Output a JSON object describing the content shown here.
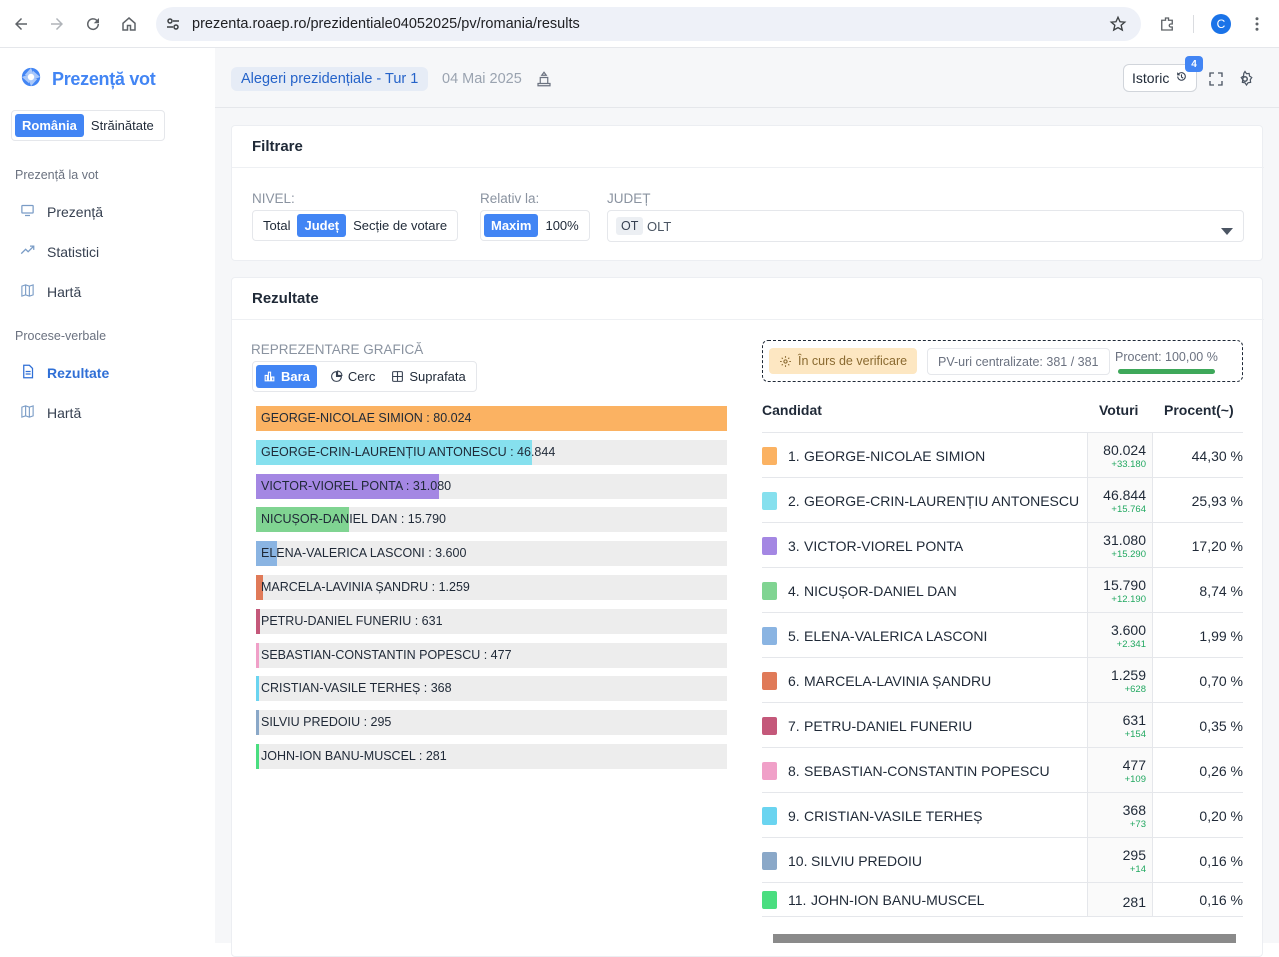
{
  "browser": {
    "url": "prezenta.roaep.ro/prezidentiale04052025/pv/romania/results",
    "profile_initial": "C"
  },
  "sidebar": {
    "app_name": "Prezență vot",
    "scope_tabs": [
      {
        "label": "România",
        "active": true
      },
      {
        "label": "Străinătate",
        "active": false
      }
    ],
    "section1_title": "Prezență la vot",
    "section1_items": [
      {
        "label": "Prezență",
        "icon": "monitor-icon"
      },
      {
        "label": "Statistici",
        "icon": "trend-icon"
      },
      {
        "label": "Hartă",
        "icon": "map-icon"
      }
    ],
    "section2_title": "Procese-verbale",
    "section2_items": [
      {
        "label": "Rezultate",
        "icon": "document-icon",
        "active": true
      },
      {
        "label": "Hartă",
        "icon": "map-icon"
      }
    ]
  },
  "header": {
    "election": "Alegeri prezidențiale - Tur 1",
    "date": "04 Mai 2025",
    "history_label": "Istoric",
    "history_badge": "4"
  },
  "filters": {
    "title": "Filtrare",
    "level_label": "NIVEL:",
    "level_options": [
      {
        "label": "Total",
        "active": false
      },
      {
        "label": "Județ",
        "active": true
      },
      {
        "label": "Secție de votare",
        "active": false
      }
    ],
    "relative_label": "Relativ la:",
    "relative_options": [
      {
        "label": "Maxim",
        "active": true
      },
      {
        "label": "100%",
        "active": false
      }
    ],
    "county_label": "JUDEȚ",
    "county_code": "OT",
    "county_name": "OLT"
  },
  "results": {
    "title": "Rezultate",
    "chart_label": "REPREZENTARE GRAFICĂ",
    "chart_modes": [
      {
        "label": "Bara",
        "active": true
      },
      {
        "label": "Cerc",
        "active": false
      },
      {
        "label": "Suprafata",
        "active": false
      }
    ],
    "status": "În curs de verificare",
    "pv_centralized": "PV-uri centralizate: 381 / 381",
    "percent_label": "Procent: 100,00 %",
    "percent_value": 100,
    "table_headers": {
      "candidate": "Candidat",
      "votes": "Voturi",
      "percent": "Procent(~)"
    },
    "candidates": [
      {
        "rank": "1.",
        "name": "GEORGE-NICOLAE SIMION",
        "votes": "80.024",
        "delta": "+33.180",
        "pct": "44,30 %",
        "color": "#fbb262"
      },
      {
        "rank": "2.",
        "name": "GEORGE-CRIN-LAURENȚIU ANTONESCU",
        "votes": "46.844",
        "delta": "+15.764",
        "pct": "25,93 %",
        "color": "#86e0ee"
      },
      {
        "rank": "3.",
        "name": "VICTOR-VIOREL PONTA",
        "votes": "31.080",
        "delta": "+15.290",
        "pct": "17,20 %",
        "color": "#a487e3"
      },
      {
        "rank": "4.",
        "name": "NICUȘOR-DANIEL DAN",
        "votes": "15.790",
        "delta": "+12.190",
        "pct": "8,74 %",
        "color": "#80d492"
      },
      {
        "rank": "5.",
        "name": "ELENA-VALERICA LASCONI",
        "votes": "3.600",
        "delta": "+2.341",
        "pct": "1,99 %",
        "color": "#8ab4e2"
      },
      {
        "rank": "6.",
        "name": "MARCELA-LAVINIA ȘANDRU",
        "votes": "1.259",
        "delta": "+628",
        "pct": "0,70 %",
        "color": "#e07a58"
      },
      {
        "rank": "7.",
        "name": "PETRU-DANIEL FUNERIU",
        "votes": "631",
        "delta": "+154",
        "pct": "0,35 %",
        "color": "#c4587a"
      },
      {
        "rank": "8.",
        "name": "SEBASTIAN-CONSTANTIN POPESCU",
        "votes": "477",
        "delta": "+109",
        "pct": "0,26 %",
        "color": "#f0a0c8"
      },
      {
        "rank": "9.",
        "name": "CRISTIAN-VASILE TERHEȘ",
        "votes": "368",
        "delta": "+73",
        "pct": "0,20 %",
        "color": "#6ad4f0"
      },
      {
        "rank": "10.",
        "name": "SILVIU PREDOIU",
        "votes": "295",
        "delta": "+14",
        "pct": "0,16 %",
        "color": "#8aa8c8"
      },
      {
        "rank": "11.",
        "name": "JOHN-ION BANU-MUSCEL",
        "votes": "281",
        "delta": "",
        "pct": "0,16 %",
        "color": "#4ade80"
      }
    ]
  },
  "chart_data": {
    "type": "bar",
    "orientation": "horizontal",
    "categories": [
      "GEORGE-NICOLAE SIMION",
      "GEORGE-CRIN-LAURENȚIU ANTONESCU",
      "VICTOR-VIOREL PONTA",
      "NICUȘOR-DANIEL DAN",
      "ELENA-VALERICA LASCONI",
      "MARCELA-LAVINIA ȘANDRU",
      "PETRU-DANIEL FUNERIU",
      "SEBASTIAN-CONSTANTIN POPESCU",
      "CRISTIAN-VASILE TERHEȘ",
      "SILVIU PREDOIU",
      "JOHN-ION BANU-MUSCEL"
    ],
    "values": [
      80024,
      46844,
      31080,
      15790,
      3600,
      1259,
      631,
      477,
      368,
      295,
      281
    ],
    "labels": [
      "GEORGE-NICOLAE SIMION : 80.024",
      "GEORGE-CRIN-LAURENȚIU ANTONESCU : 46.844",
      "VICTOR-VIOREL PONTA : 31.080",
      "NICUȘOR-DANIEL DAN : 15.790",
      "ELENA-VALERICA LASCONI : 3.600",
      "MARCELA-LAVINIA ȘANDRU : 1.259",
      "PETRU-DANIEL FUNERIU : 631",
      "SEBASTIAN-CONSTANTIN POPESCU : 477",
      "CRISTIAN-VASILE TERHEȘ : 368",
      "SILVIU PREDOIU : 295",
      "JOHN-ION BANU-MUSCEL : 281"
    ],
    "colors": [
      "#fbb262",
      "#86e0ee",
      "#a487e3",
      "#80d492",
      "#8ab4e2",
      "#e07a58",
      "#c4587a",
      "#f0a0c8",
      "#6ad4f0",
      "#8aa8c8",
      "#4ade80"
    ],
    "xlim": [
      0,
      80024
    ]
  }
}
